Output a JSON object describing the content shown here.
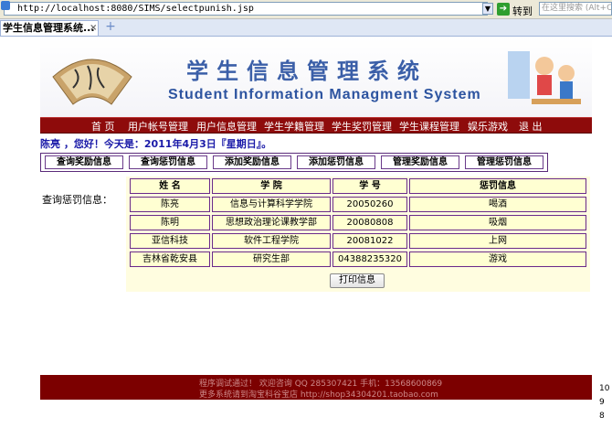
{
  "browser": {
    "url": "http://localhost:8080/SIMS/selectpunish.jsp",
    "go_label": "转到",
    "search_placeholder": "在这里搜索 (Alt+C)",
    "tab_title": "学生信息管理系统...",
    "tab_close": "×",
    "new_tab": "+"
  },
  "banner": {
    "title_zh": "学生信息管理系统",
    "title_en": "Student Information Managment System"
  },
  "nav": {
    "items": [
      "首 页",
      "用户帐号管理",
      "用户信息管理",
      "学生学籍管理",
      "学生奖罚管理",
      "学生课程管理",
      "娱乐游戏",
      "退 出"
    ]
  },
  "greeting": "陈亮 ，您好！今天是：2011年4月3日『星期日』。",
  "functions": [
    "查询奖励信息",
    "查询惩罚信息",
    "添加奖励信息",
    "添加惩罚信息",
    "管理奖励信息",
    "管理惩罚信息"
  ],
  "query_label": "查询惩罚信息：",
  "table": {
    "headers": [
      "姓 名",
      "学 院",
      "学 号",
      "惩罚信息"
    ],
    "rows": [
      [
        "陈亮",
        "信息与计算科学学院",
        "20050260",
        "喝酒"
      ],
      [
        "陈明",
        "思想政治理论课教学部",
        "20080808",
        "吸烟"
      ],
      [
        "亚信科技",
        "软件工程学院",
        "20081022",
        "上网"
      ],
      [
        "吉林省乾安县",
        "研究生部",
        "04388235320",
        "游戏"
      ]
    ]
  },
  "print_label": "打印信息",
  "footer": {
    "line1": "程序调试通过！ 欢迎咨询  QQ 285307421  手机：13568600869",
    "line2": "更多系统请到淘宝科谷宝店 http://shop34304201.taobao.com"
  },
  "side_numbers": [
    "10",
    "9",
    "8"
  ],
  "colors": {
    "nav_bg": "#8e0b0b",
    "footer_bg": "#7c0000",
    "table_cell": "#ffffd2",
    "title_blue": "#3b5fa8"
  }
}
